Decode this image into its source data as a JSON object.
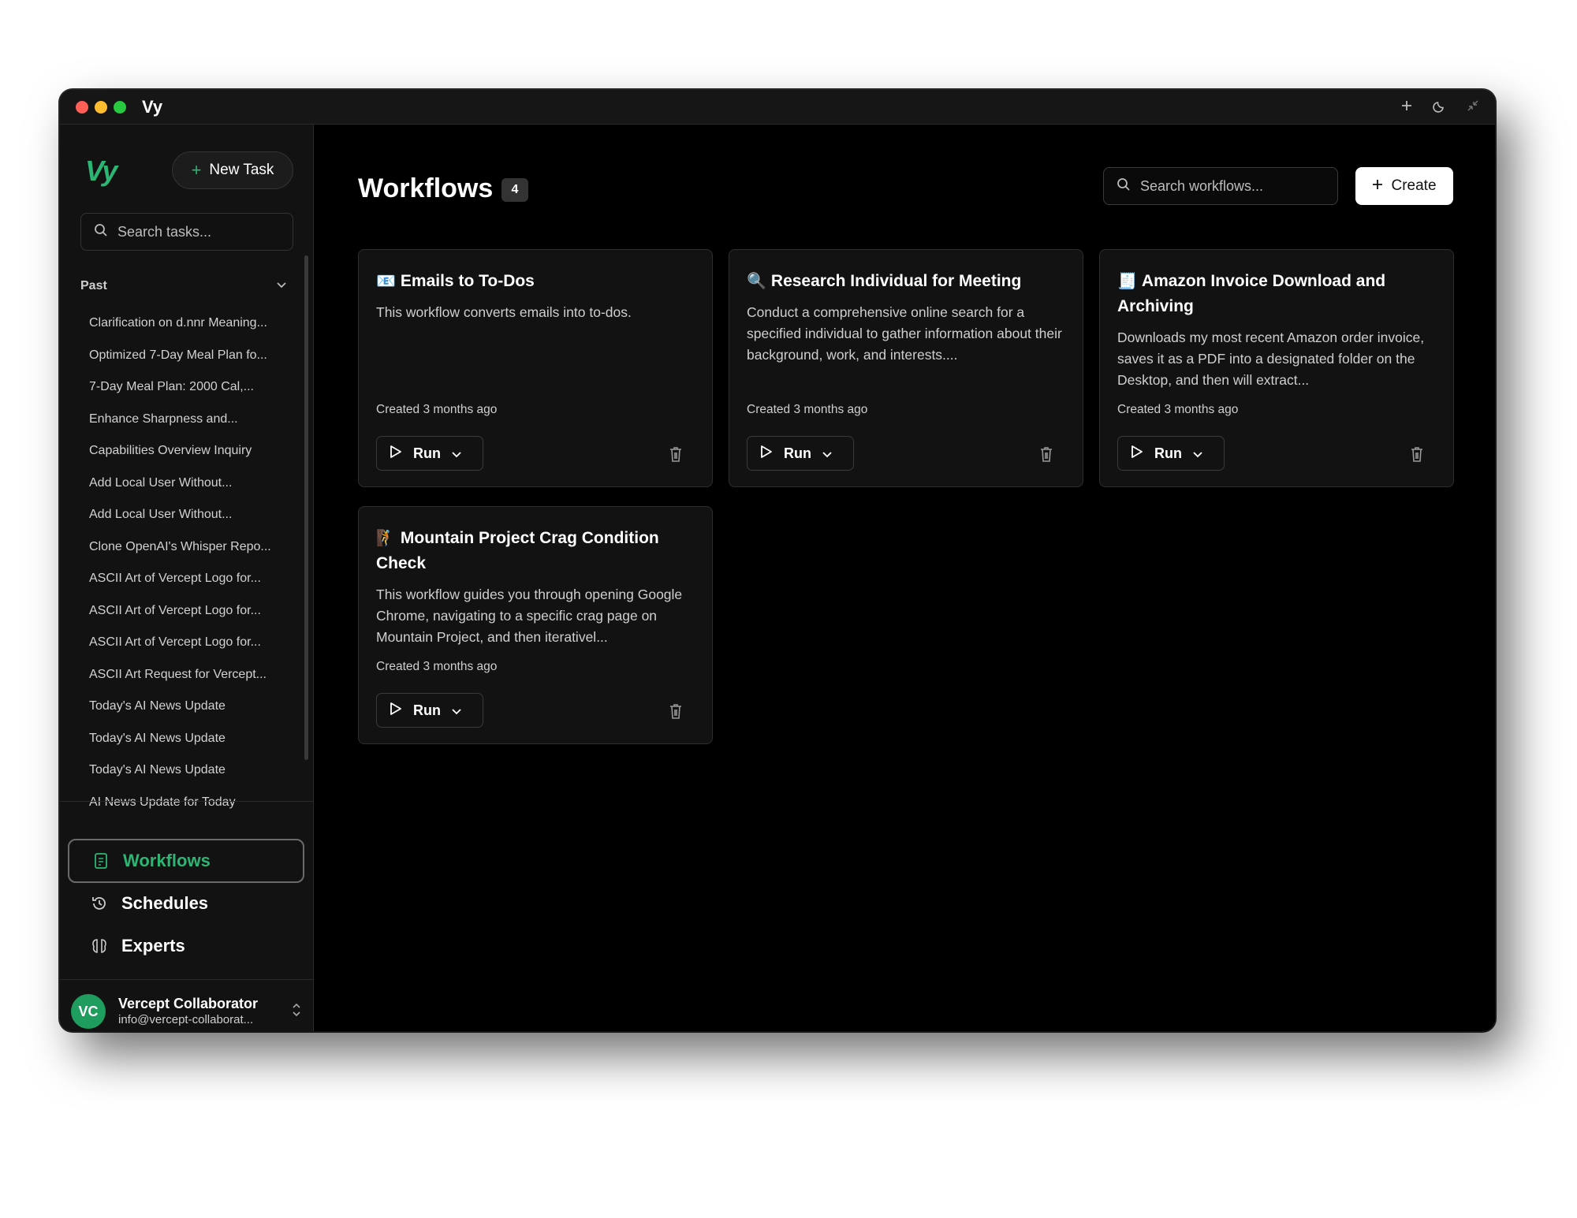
{
  "window": {
    "app_title": "Vy",
    "traffic_colors": [
      "#ff5f57",
      "#febc2e",
      "#28c840"
    ]
  },
  "sidebar": {
    "logo": "Vy",
    "new_task_label": "New Task",
    "search_placeholder": "Search tasks...",
    "past_label": "Past",
    "tasks": [
      "Clarification on d.nnr Meaning...",
      "Optimized 7-Day Meal Plan fo...",
      "7-Day Meal Plan: 2000 Cal,...",
      "Enhance Sharpness and...",
      "Capabilities Overview Inquiry",
      "Add Local User Without...",
      "Add Local User Without...",
      "Clone OpenAI's Whisper Repo...",
      "ASCII Art of Vercept Logo for...",
      "ASCII Art of Vercept Logo for...",
      "ASCII Art of Vercept Logo for...",
      "ASCII Art Request for Vercept...",
      "Today's AI News Update",
      "Today's AI News Update",
      "Today's AI News Update",
      "AI News Update for Today"
    ],
    "nav": {
      "workflows": "Workflows",
      "schedules": "Schedules",
      "experts": "Experts"
    },
    "user": {
      "initials": "VC",
      "name": "Vercept Collaborator",
      "email": "info@vercept-collaborat..."
    }
  },
  "main": {
    "title": "Workflows",
    "count": "4",
    "search_placeholder": "Search workflows...",
    "create_label": "Create",
    "accent_color": "#2bb673",
    "cards": [
      {
        "emoji": "📧",
        "title": "Emails to To-Dos",
        "description": "This workflow converts emails into to-dos.",
        "created": "Created 3 months ago",
        "run_label": "Run"
      },
      {
        "emoji": "🔍",
        "title": "Research Individual for Meeting",
        "description": "Conduct a comprehensive online search for a specified individual to gather information about their background, work, and interests....",
        "created": "Created 3 months ago",
        "run_label": "Run"
      },
      {
        "emoji": "🧾",
        "title": "Amazon Invoice Download and Archiving",
        "description": "Downloads my most recent Amazon order invoice, saves it as a PDF into a designated folder on the Desktop, and then will extract...",
        "created": "Created 3 months ago",
        "run_label": "Run"
      },
      {
        "emoji": "🧗",
        "title": "Mountain Project Crag Condition Check",
        "description": "This workflow guides you through opening Google Chrome, navigating to a specific crag page on Mountain Project, and then iterativel...",
        "created": "Created 3 months ago",
        "run_label": "Run"
      }
    ]
  }
}
